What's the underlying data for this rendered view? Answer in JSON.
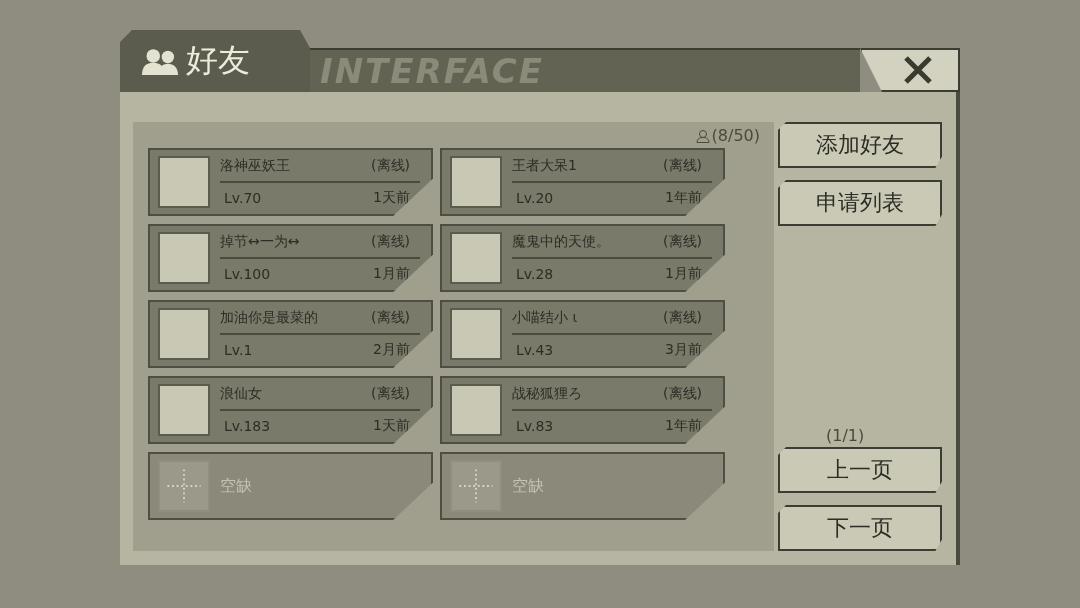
{
  "window": {
    "title": "好友",
    "header_decoration": "INTERFACE"
  },
  "friend_count": "(8/50)",
  "friends": [
    {
      "kind": "friend",
      "name": "洛神巫妖王",
      "status": "(离线)",
      "level": "Lv.70",
      "last_seen": "1天前"
    },
    {
      "kind": "friend",
      "name": "王者大呆1",
      "status": "(离线)",
      "level": "Lv.20",
      "last_seen": "1年前"
    },
    {
      "kind": "friend",
      "name": "掉节↔一为↔",
      "status": "(离线)",
      "level": "Lv.100",
      "last_seen": "1月前"
    },
    {
      "kind": "friend",
      "name": "魔鬼中的天使。",
      "status": "(离线)",
      "level": "Lv.28",
      "last_seen": "1月前"
    },
    {
      "kind": "friend",
      "name": "加油你是最菜的",
      "status": "(离线)",
      "level": "Lv.1",
      "last_seen": "2月前"
    },
    {
      "kind": "friend",
      "name": "小喵结小 ι",
      "status": "(离线)",
      "level": "Lv.43",
      "last_seen": "3月前"
    },
    {
      "kind": "friend",
      "name": "浪仙女",
      "status": "(离线)",
      "level": "Lv.183",
      "last_seen": "1天前"
    },
    {
      "kind": "friend",
      "name": "战秘狐狸ろ",
      "status": "(离线)",
      "level": "Lv.83",
      "last_seen": "1年前"
    },
    {
      "kind": "empty",
      "name": "空缺"
    },
    {
      "kind": "empty",
      "name": "空缺"
    }
  ],
  "actions": [
    "添加好友",
    "申请列表"
  ],
  "pagination": {
    "page": "(1/1)",
    "buttons": [
      "上一页",
      "下一页"
    ]
  }
}
